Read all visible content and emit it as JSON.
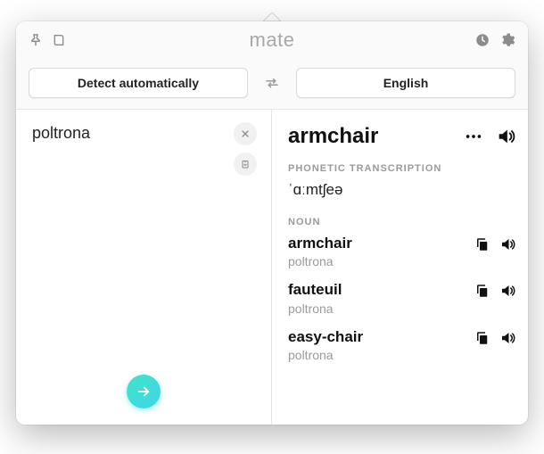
{
  "app": {
    "title": "mate"
  },
  "langbar": {
    "source_label": "Detect automatically",
    "target_label": "English"
  },
  "source": {
    "text": "poltrona"
  },
  "result": {
    "headword": "armchair",
    "phonetic_label": "PHONETIC TRANSCRIPTION",
    "phonetic": "ˈɑːmtʃeə",
    "pos_label": "NOUN",
    "senses": [
      {
        "word": "armchair",
        "back": "poltrona"
      },
      {
        "word": "fauteuil",
        "back": "poltrona"
      },
      {
        "word": "easy-chair",
        "back": "poltrona"
      }
    ]
  }
}
